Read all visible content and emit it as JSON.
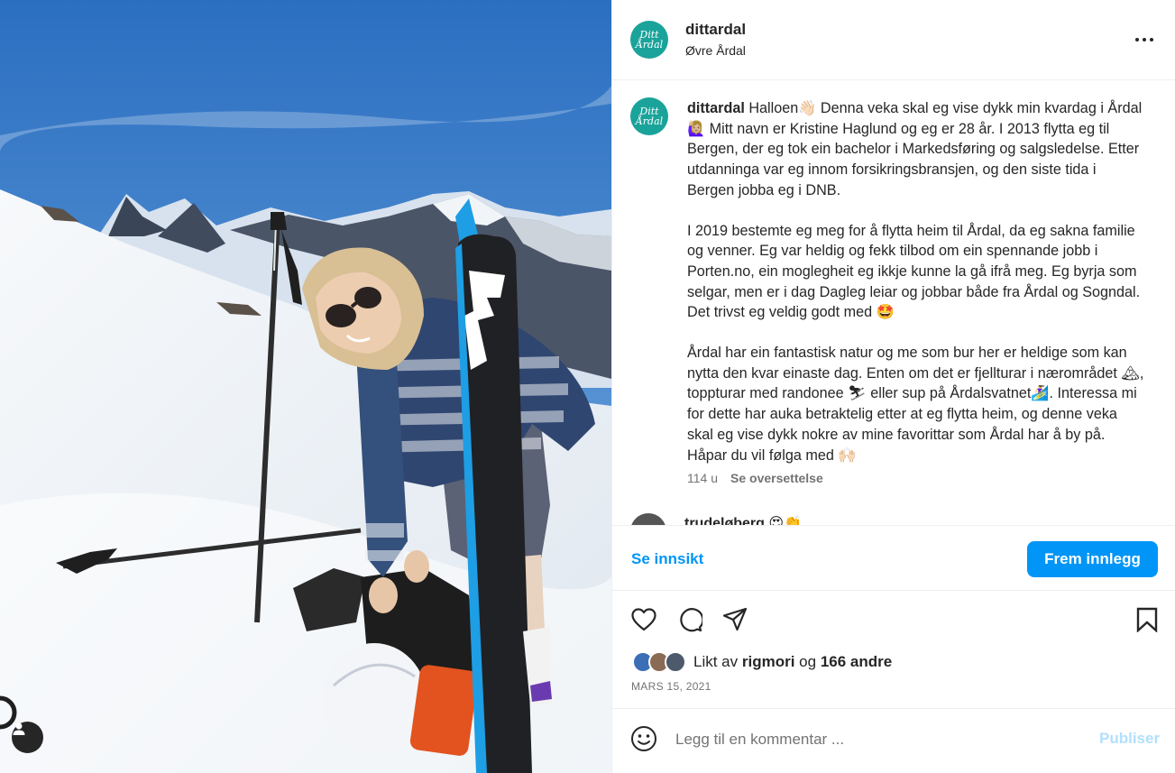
{
  "post": {
    "username": "dittardal",
    "location": "Øvre Årdal",
    "avatar_text": "Ditt Årdal"
  },
  "caption": {
    "username": "dittardal",
    "paragraph1": "Halloen👋🏻 Denna veka skal eg vise dykk min kvardag i Årdal 🙋🏼‍♀️ Mitt navn er Kristine Haglund og eg er 28 år. I 2013 flytta eg til Bergen, der eg tok ein bachelor i Markedsføring og salgsledelse. Etter utdanninga var eg innom forsikringsbransjen, og den siste tida i Bergen jobba eg i DNB.",
    "paragraph2": "I 2019 bestemte eg meg for å flytta heim til Årdal, da eg sakna familie og venner. Eg var heldig og fekk tilbod om ein spennande jobb i Porten.no, ein moglegheit eg ikkje kunne la gå ifrå meg. Eg byrja som selgar, men er i dag Dagleg leiar og jobbar både fra Årdal og Sogndal. Det trivst eg veldig godt med 🤩",
    "paragraph3": "Årdal har ein fantastisk natur og me som bur her er heldige som kan nytta den kvar einaste dag. Enten om det er fjellturar i nærområdet 🏔, toppturar med randonee ⛷ eller sup på Årdalsvatnet🏄‍♀️. Interessa mi for dette har auka betraktelig etter at eg flytta heim, og denne veka skal eg vise dykk nokre av mine favorittar som Årdal har å by på. Håpar du vil følga med 🙌🏻",
    "age": "114 u",
    "translate": "Se oversettelse"
  },
  "next_comment": {
    "username": "trudeløberg 😍👏"
  },
  "insight": {
    "link": "Se innsikt",
    "promote": "Frem innlegg"
  },
  "likes": {
    "prefix": "Likt av",
    "first_liker": "rigmori",
    "connector": "og",
    "others": "166 andre"
  },
  "date": "MARS 15, 2021",
  "comment": {
    "placeholder": "Legg til en kommentar ...",
    "publish": "Publiser"
  },
  "icons": {
    "heart": "heart-icon",
    "comment": "comment-icon",
    "share": "share-icon",
    "save": "bookmark-icon",
    "emoji": "emoji-icon",
    "more": "more-icon",
    "tag": "user-tag-icon"
  },
  "colors": {
    "accent": "#0095f6",
    "brand": "#1aa39a",
    "muted": "#737373"
  }
}
